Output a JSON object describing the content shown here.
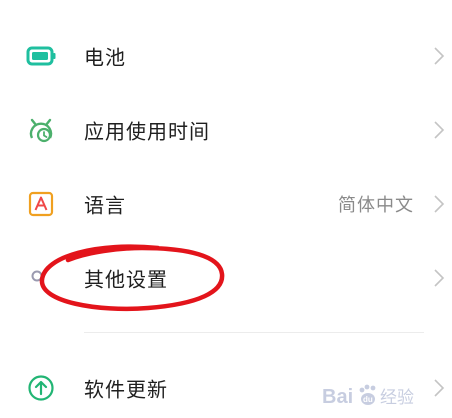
{
  "settings": {
    "items": [
      {
        "label": "电池",
        "value": "",
        "icon": "battery-icon",
        "color": "#1fbf9f"
      },
      {
        "label": "应用使用时间",
        "value": "",
        "icon": "app-usage-timer-icon",
        "color": "#4cb06c"
      },
      {
        "label": "语言",
        "value": "简体中文",
        "icon": "language-icon",
        "color": "#f0a020"
      },
      {
        "label": "其他设置",
        "value": "",
        "icon": "other-settings-icon",
        "color": "#9a9ab0"
      },
      {
        "label": "软件更新",
        "value": "",
        "icon": "update-arrow-icon",
        "color": "#22b574"
      }
    ]
  },
  "annotation": {
    "color": "#e3141b"
  },
  "watermark": {
    "text": "Bai",
    "paw": "du",
    "suffix": "经验"
  }
}
